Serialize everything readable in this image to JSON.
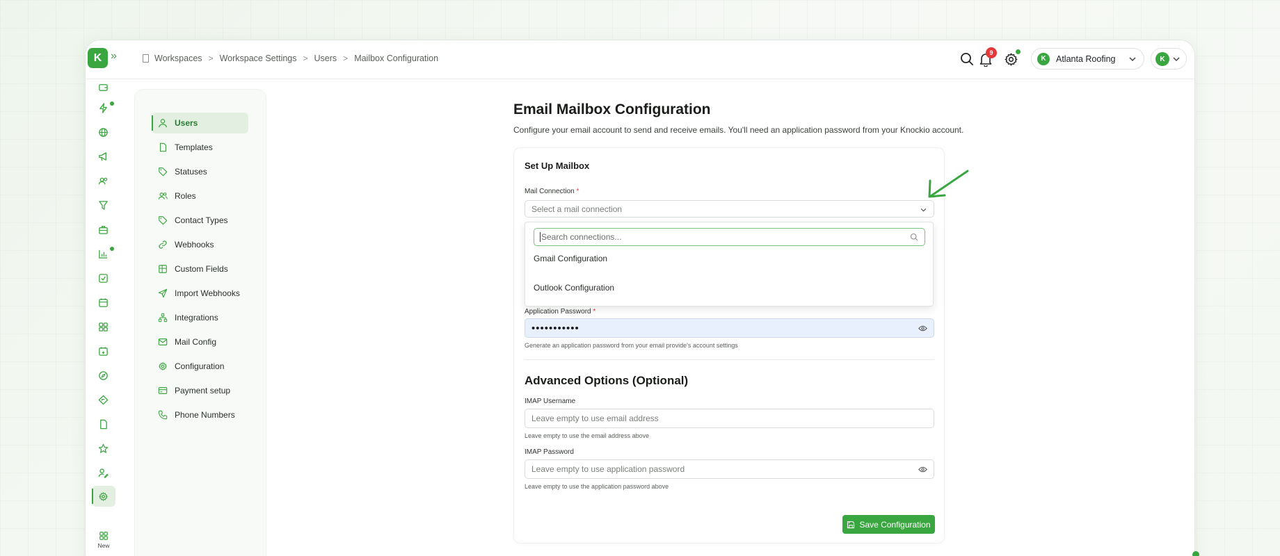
{
  "app": {
    "logo_letter": "K",
    "breadcrumb": [
      "Workspaces",
      "Workspace Settings",
      "Users",
      "Mailbox Configuration"
    ],
    "notification_count": "9",
    "workspace_name": "Atlanta Roofing",
    "workspace_logo_letter": "K",
    "user_avatar_letter": "K",
    "accent_color": "#3aa63f"
  },
  "rail": {
    "icons": [
      "wallet-icon",
      "lightning-icon",
      "globe-icon",
      "megaphone-icon",
      "contacts-icon",
      "funnel-icon",
      "briefcase-icon",
      "bar-chart-icon",
      "checkbox-icon",
      "calendar-icon",
      "grid-icon",
      "calendar-plus-icon",
      "compass-icon",
      "route-icon",
      "file-icon",
      "star-icon",
      "user-edit-icon",
      "gear-icon"
    ],
    "new_label": "New"
  },
  "settings_nav": {
    "items": [
      {
        "label": "Users",
        "icon": "user-icon",
        "active": true
      },
      {
        "label": "Templates",
        "icon": "file-icon"
      },
      {
        "label": "Statuses",
        "icon": "tag-icon"
      },
      {
        "label": "Roles",
        "icon": "users-icon"
      },
      {
        "label": "Contact Types",
        "icon": "tag-icon"
      },
      {
        "label": "Webhooks",
        "icon": "link-icon"
      },
      {
        "label": "Custom Fields",
        "icon": "table-icon"
      },
      {
        "label": "Import Webhooks",
        "icon": "send-icon"
      },
      {
        "label": "Integrations",
        "icon": "network-icon"
      },
      {
        "label": "Mail Config",
        "icon": "mail-icon"
      },
      {
        "label": "Configuration",
        "icon": "gear-icon"
      },
      {
        "label": "Payment setup",
        "icon": "credit-card-icon"
      },
      {
        "label": "Phone Numbers",
        "icon": "phone-icon"
      }
    ]
  },
  "main": {
    "title": "Email Mailbox Configuration",
    "description": "Configure your email account to send and receive emails. You'll need an application password from your Knockio account.",
    "card": {
      "section_title": "Set Up Mailbox",
      "mail_connection_label": "Mail Connection",
      "required_mark": "*",
      "mail_connection_placeholder": "Select a mail connection",
      "app_password_label": "Application Password",
      "app_password_value": "•••••••••••",
      "app_password_hint": "Generate an application password from your email provide's account settings",
      "advanced_title": "Advanced Options (Optional)",
      "imap_username_label": "IMAP Username",
      "imap_username_placeholder": "Leave empty to use email address",
      "imap_username_hint": "Leave empty to use the email address above",
      "imap_password_label": "IMAP Password",
      "imap_password_placeholder": "Leave empty to use application password",
      "imap_password_hint": "Leave empty to use the application password above",
      "save_label": "Save Configuration"
    },
    "dropdown": {
      "search_placeholder": "Search connections...",
      "options": [
        "Gmail Configuration",
        "Outlook Configuration"
      ]
    }
  }
}
